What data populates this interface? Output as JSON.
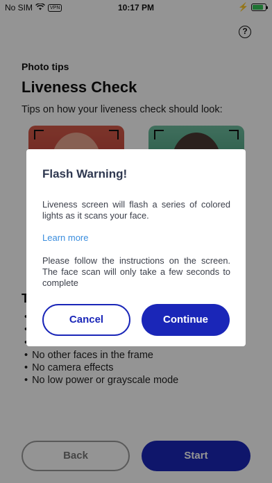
{
  "status_bar": {
    "carrier": "No SIM",
    "vpn": "VPN",
    "time": "10:17 PM",
    "battery_level": 0.85
  },
  "header": {
    "help_icon": "question-mark-circle-icon",
    "help_glyph": "?"
  },
  "page": {
    "kicker": "Photo tips",
    "title": "Liveness Check",
    "subtitle": "Tips on how your liveness check should look:"
  },
  "tips": {
    "heading": "T",
    "items": [
      "",
      "",
      "",
      "No other faces in the frame",
      "No camera effects",
      "No low power or grayscale mode"
    ],
    "partial_visible": "e"
  },
  "footer": {
    "back_label": "Back",
    "start_label": "Start"
  },
  "dialog": {
    "title": "Flash Warning!",
    "body_1": "Liveness screen will flash a series of colored lights as it scans your face.",
    "link": "Learn more",
    "body_2": "Please follow the instructions on the screen. The face scan will only take a few seconds to complete",
    "cancel_label": "Cancel",
    "continue_label": "Continue"
  },
  "colors": {
    "primary": "#1a26b8",
    "link": "#3a8dde",
    "dialog_title": "#2f3850",
    "overlay": "rgba(0,0,0,0.42)"
  }
}
